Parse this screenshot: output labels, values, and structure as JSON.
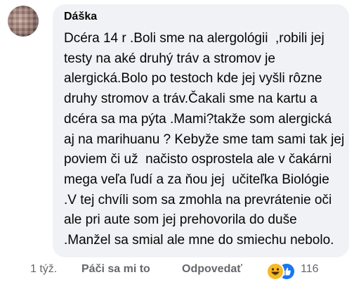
{
  "comment": {
    "author": "Dáška",
    "text": "Dcéra 14 r .Boli sme na alergológii  ,robili jej testy na aké druhý tráv a stromov je alergická.Bolo po testoch kde jej vyšli rôzne druhy stromov a tráv.Čakali sme na kartu a dcéra sa ma pýta .Mami?takže som alergická aj na marihuanu ? Kebyže sme tam sami tak jej poviem či už  načisto osprostela ale v čakárni mega veľa ľudí a za ňou jej  učiteľka Biológie .V tej chvíli som sa zmohla na prevrátenie oči ale pri aute som jej prehovorila do duše .Manžel sa smial ale mne do smiechu nebolo."
  },
  "actions": {
    "time": "1 týž.",
    "like_label": "Páči sa mi to",
    "reply_label": "Odpovedať",
    "reaction_count": "116",
    "reaction_icons": [
      "haha-icon",
      "like-icon"
    ],
    "reaction_colors": {
      "haha": "#f7b928",
      "like": "#1877f2"
    }
  }
}
